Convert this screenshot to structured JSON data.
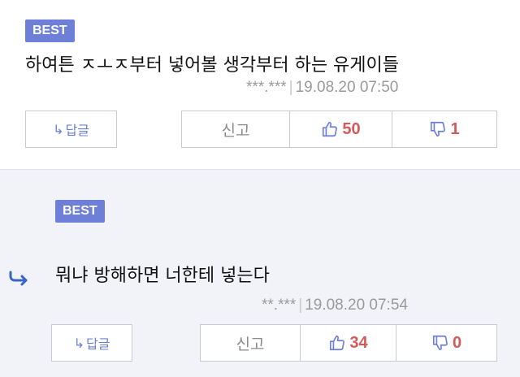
{
  "comments": [
    {
      "badge": "BEST",
      "text": "하여튼 ㅈㅗㅈ부터 넣어볼 생각부터 하는 유게이들",
      "author": "***.***",
      "date": "19.08.20 07:50",
      "reply_label": "답글",
      "report_label": "신고",
      "likes": "50",
      "dislikes": "1"
    },
    {
      "badge": "BEST",
      "text": "뭐냐 방해하면 너한테 넣는다",
      "author": "**.***",
      "date": "19.08.20 07:54",
      "reply_label": "답글",
      "report_label": "신고",
      "likes": "34",
      "dislikes": "0"
    }
  ],
  "meta_separator": "|",
  "icons": {
    "reply": "reply-arrow-icon",
    "like": "thumbs-up-icon",
    "dislike": "thumbs-down-icon",
    "nested": "nested-reply-arrow-icon"
  },
  "colors": {
    "badge": "#6d7fd6",
    "count": "#d25a5a",
    "icon": "#6d7fd6",
    "nested_arrow": "#3a64c8"
  }
}
